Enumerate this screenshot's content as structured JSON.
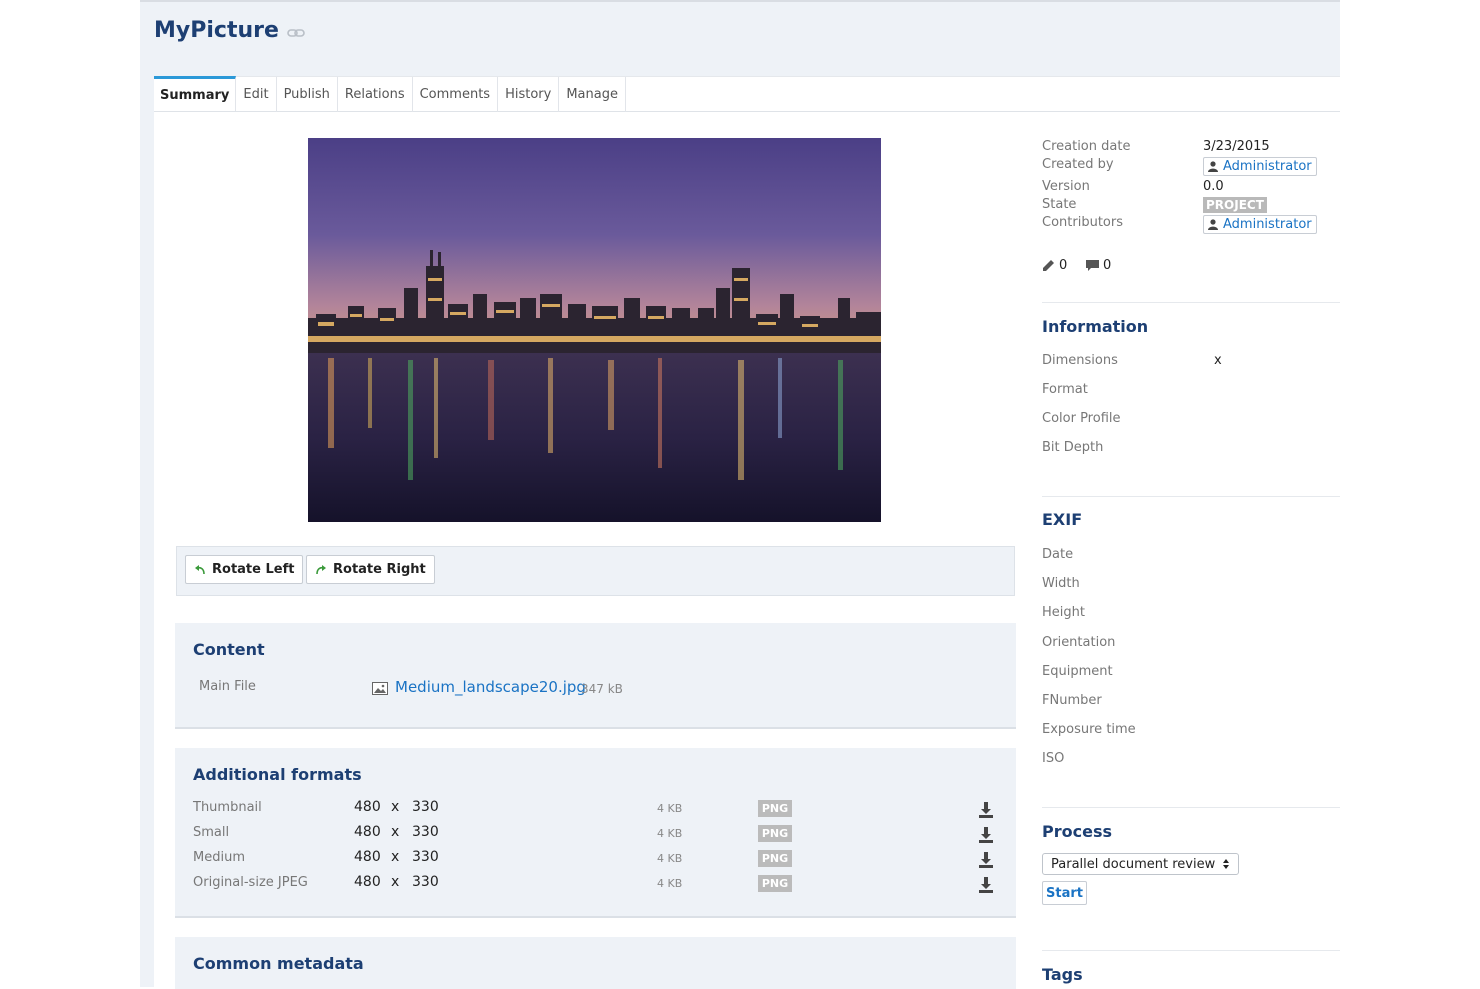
{
  "document": {
    "title": "MyPicture"
  },
  "tabs": [
    "Summary",
    "Edit",
    "Publish",
    "Relations",
    "Comments",
    "History",
    "Manage"
  ],
  "rotate": {
    "left": "Rotate Left",
    "right": "Rotate Right"
  },
  "content": {
    "title": "Content",
    "main_file_label": "Main File",
    "file_name": "Medium_landscape20.jpg",
    "file_size": "347 kB"
  },
  "additional_formats": {
    "title": "Additional formats",
    "rows": [
      {
        "name": "Thumbnail",
        "w": "480",
        "x": "x",
        "h": "330",
        "size": "4 KB",
        "type": "PNG"
      },
      {
        "name": "Small",
        "w": "480",
        "x": "x",
        "h": "330",
        "size": "4 KB",
        "type": "PNG"
      },
      {
        "name": "Medium",
        "w": "480",
        "x": "x",
        "h": "330",
        "size": "4 KB",
        "type": "PNG"
      },
      {
        "name": "Original-size JPEG",
        "w": "480",
        "x": "x",
        "h": "330",
        "size": "4 KB",
        "type": "PNG"
      }
    ]
  },
  "common_metadata": {
    "title": "Common metadata"
  },
  "summary": {
    "creation_date_label": "Creation date",
    "creation_date": "3/23/2015",
    "created_by_label": "Created by",
    "created_by": "Administrator",
    "version_label": "Version",
    "version": "0.0",
    "state_label": "State",
    "state": "PROJECT",
    "contributors_label": "Contributors",
    "contributor": "Administrator",
    "edit_count": "0",
    "comment_count": "0"
  },
  "information": {
    "title": "Information",
    "dimensions_label": "Dimensions",
    "dimensions_value": "x",
    "format_label": "Format",
    "color_profile_label": "Color Profile",
    "bit_depth_label": "Bit Depth"
  },
  "exif": {
    "title": "EXIF",
    "labels": [
      "Date",
      "Width",
      "Height",
      "Orientation",
      "Equipment",
      "FNumber",
      "Exposure time",
      "ISO"
    ]
  },
  "process": {
    "title": "Process",
    "selected": "Parallel document review",
    "start": "Start"
  },
  "tags": {
    "title": "Tags"
  },
  "colors": {
    "title_blue": "#1d3f73",
    "link_blue": "#1a73c4",
    "tab_accent": "#2b99d8",
    "panel_bg": "#eef2f7",
    "badge_gray": "#b9b9b9"
  }
}
